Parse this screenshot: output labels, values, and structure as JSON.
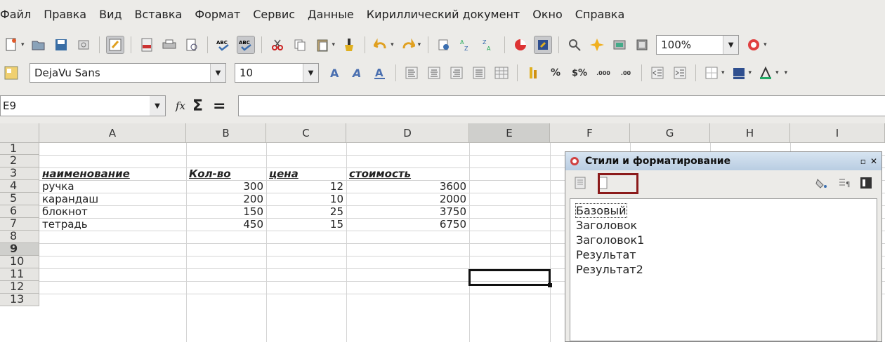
{
  "menu": [
    "Файл",
    "Правка",
    "Вид",
    "Вставка",
    "Формат",
    "Сервис",
    "Данные",
    "Кириллический документ",
    "Окно",
    "Справка"
  ],
  "toolbar": {
    "zoom": "100%"
  },
  "format_toolbar": {
    "font_name": "DejaVu Sans",
    "font_size": "10",
    "percent_label": "%",
    "currency_label": "$%",
    "decimal_add_label": ".000",
    "decimal_del_label": ".00"
  },
  "formula_bar": {
    "cell_ref": "E9",
    "fx_label": "fx",
    "sigma_label": "Σ",
    "equals_label": "=",
    "formula": ""
  },
  "sheet": {
    "columns": [
      "A",
      "B",
      "C",
      "D",
      "E",
      "F",
      "G",
      "H",
      "I"
    ],
    "selected_column": "E",
    "rows": [
      "1",
      "2",
      "3",
      "4",
      "5",
      "6",
      "7",
      "8",
      "9",
      "10",
      "11",
      "12",
      "13"
    ],
    "selected_row": "9",
    "headers": {
      "a3": "наименование",
      "b3": "Кол-во",
      "c3": "цена",
      "d3": "стоимость"
    },
    "data": [
      {
        "name": "ручка",
        "qty": "300",
        "price": "12",
        "cost": "3600"
      },
      {
        "name": "карандаш",
        "qty": "200",
        "price": "10",
        "cost": "2000"
      },
      {
        "name": "блокнот",
        "qty": "150",
        "price": "25",
        "cost": "3750"
      },
      {
        "name": "тетрадь",
        "qty": "450",
        "price": "15",
        "cost": "6750"
      }
    ]
  },
  "styles_panel": {
    "title": "Стили и форматирование",
    "items": [
      "Базовый",
      "Заголовок",
      "Заголовок1",
      "Результат",
      "Результат2"
    ],
    "selected": "Базовый",
    "highlight_color": "#8b1a1a",
    "title_bar_color": "#c6d7ea"
  },
  "icons": [
    "new-document-icon",
    "save-icon",
    "edit-icon",
    "pdf-icon",
    "print-icon",
    "spellcheck-icon",
    "cut-icon",
    "copy-icon",
    "paste-icon",
    "undo-icon",
    "redo-icon",
    "sort-asc-icon",
    "sort-desc-icon",
    "chart-icon",
    "navigator-icon",
    "help-icon"
  ]
}
